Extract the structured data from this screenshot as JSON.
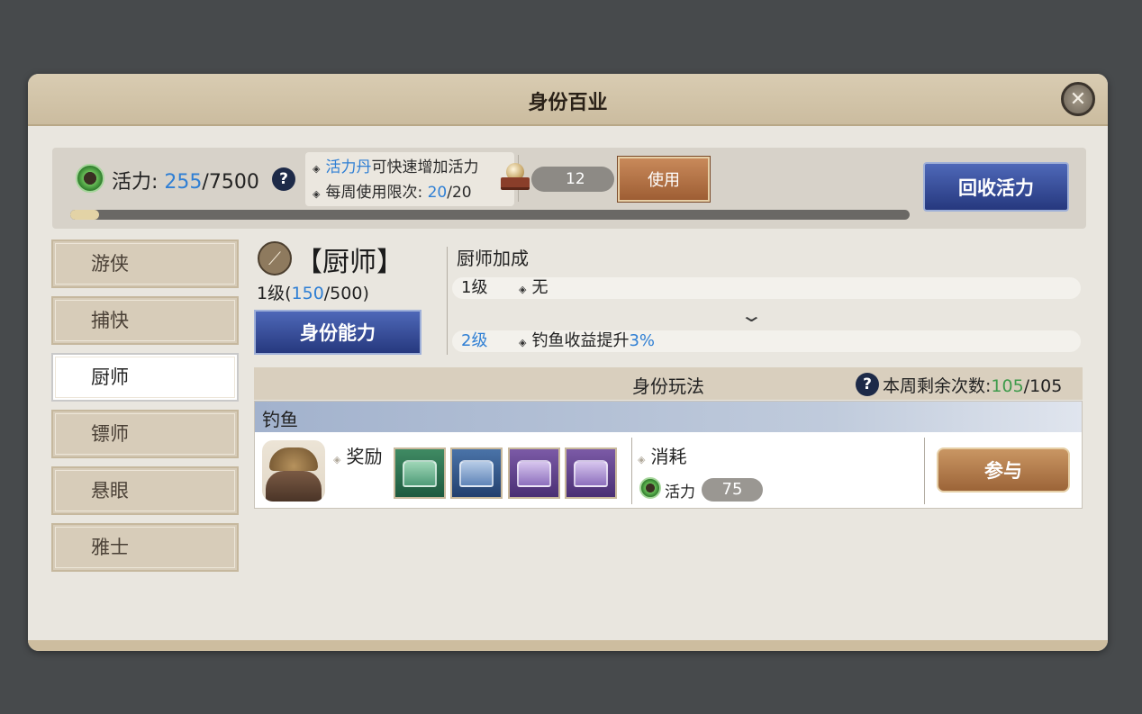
{
  "window": {
    "title": "身份百业"
  },
  "vigor": {
    "label": "活力:",
    "current": "255",
    "max": "/7500",
    "progress_fraction": 0.034
  },
  "tips": {
    "line1_highlight": "活力丹",
    "line1_rest": "可快速增加活力",
    "line2_label": "每周使用限次:",
    "line2_used": "20",
    "line2_max": "/20"
  },
  "item": {
    "count": "12",
    "use_label": "使用"
  },
  "reclaim_label": "回收活力",
  "sidebar": {
    "items": [
      {
        "label": "游侠",
        "active": false
      },
      {
        "label": "捕快",
        "active": false
      },
      {
        "label": "厨师",
        "active": true
      },
      {
        "label": "镖师",
        "active": false
      },
      {
        "label": "悬眼",
        "active": false
      },
      {
        "label": "雅士",
        "active": false
      }
    ]
  },
  "role": {
    "name": "【厨师】",
    "level_text": "1级(",
    "exp_current": "150",
    "exp_max": "/500)",
    "ability_label": "身份能力"
  },
  "bonus": {
    "title": "厨师加成",
    "current": {
      "level": "1级",
      "text": "无"
    },
    "next": {
      "level": "2级",
      "text": "钓鱼收益提升",
      "value": "3%"
    }
  },
  "play": {
    "title": "身份玩法",
    "remaining_label": "本周剩余次数:",
    "remaining_current": "105",
    "remaining_max": "/105",
    "activity": {
      "name": "钓鱼",
      "reward_label": "奖励",
      "rewards": [
        "green-chest",
        "blue-chest",
        "purple-chest",
        "purple-chest"
      ],
      "cost_label": "消耗",
      "cost_vigor_label": "活力",
      "cost_value": "75",
      "join_label": "参与"
    }
  },
  "colors": {
    "highlight_blue": "#2f7fd4",
    "highlight_green": "#3f9b4c",
    "button_blue": "#26387e",
    "button_brown": "#9e5e34"
  }
}
